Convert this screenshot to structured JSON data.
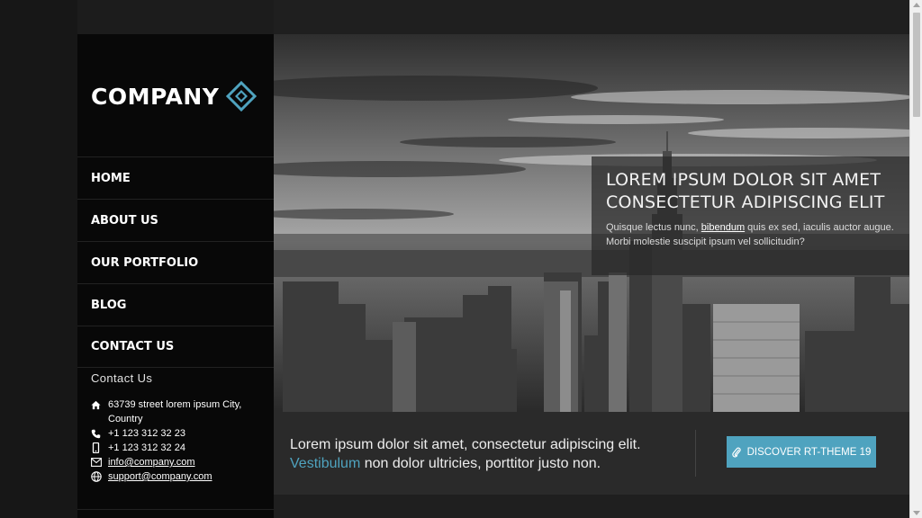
{
  "brand": {
    "name": "COMPANY",
    "accent": "#4fa3bf"
  },
  "nav": {
    "items": [
      {
        "label": "HOME"
      },
      {
        "label": "ABOUT US"
      },
      {
        "label": "OUR PORTFOLIO"
      },
      {
        "label": "BLOG"
      },
      {
        "label": "CONTACT US"
      }
    ]
  },
  "contact": {
    "heading": "Contact Us",
    "address_line1": "63739 street lorem ipsum City,",
    "address_line2": "Country",
    "phone": "+1 123 312 32 23",
    "mobile": "+1 123 312 32 24",
    "email": "info@company.com",
    "support": "support@company.com",
    "icons": [
      "home-icon",
      "phone-icon",
      "mobile-icon",
      "envelope-icon",
      "globe-icon"
    ]
  },
  "hero": {
    "title_line1": "LOREM IPSUM DOLOR SIT AMET",
    "title_line2": "CONSECTETUR ADIPISCING ELIT",
    "text_before": "Quisque lectus nunc, ",
    "text_link": "bibendum",
    "text_after": " quis ex sed, iaculis auctor augue. Morbi molestie suscipit ipsum vel sollicitudin?"
  },
  "cta": {
    "text_line1": "Lorem ipsum dolor sit amet, consectetur adipiscing elit.",
    "text_highlight": "Vestibulum",
    "text_line2_rest": " non dolor ultricies, porttitor justo non.",
    "button_label": "DISCOVER RT-THEME 19",
    "button_icon": "paperclip-icon"
  }
}
